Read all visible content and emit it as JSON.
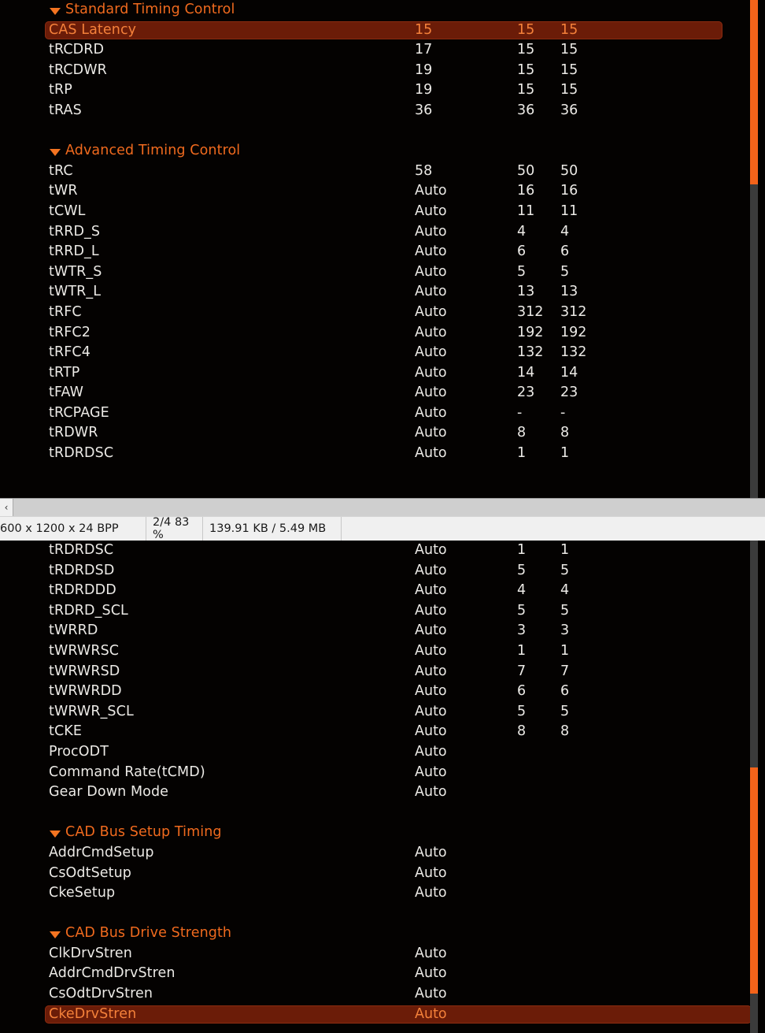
{
  "app": {
    "kind": "bios-memory-timing-screenshot-in-image-viewer"
  },
  "colors": {
    "accent_orange": "#f4631a",
    "section_header": "#f06a1e",
    "selected_row_bg": "#6b1c08",
    "selected_row_text": "#f4813a",
    "value_text": "#eceae6",
    "panel_bg": "#040201"
  },
  "panel_top": {
    "rows": [
      {
        "type": "section",
        "label": "Standard Timing Control"
      },
      {
        "type": "item",
        "label": "CAS Latency",
        "v1": "15",
        "v2": "15",
        "v3": "15",
        "selected": true
      },
      {
        "type": "item",
        "label": "tRCDRD",
        "v1": "17",
        "v2": "15",
        "v3": "15"
      },
      {
        "type": "item",
        "label": "tRCDWR",
        "v1": "19",
        "v2": "15",
        "v3": "15"
      },
      {
        "type": "item",
        "label": "tRP",
        "v1": "19",
        "v2": "15",
        "v3": "15"
      },
      {
        "type": "item",
        "label": "tRAS",
        "v1": "36",
        "v2": "36",
        "v3": "36"
      },
      {
        "type": "spacer"
      },
      {
        "type": "section",
        "label": "Advanced Timing Control"
      },
      {
        "type": "item",
        "label": "tRC",
        "v1": "58",
        "v2": "50",
        "v3": "50"
      },
      {
        "type": "item",
        "label": "tWR",
        "v1": "Auto",
        "v2": "16",
        "v3": "16"
      },
      {
        "type": "item",
        "label": "tCWL",
        "v1": "Auto",
        "v2": "11",
        "v3": "11"
      },
      {
        "type": "item",
        "label": "tRRD_S",
        "v1": "Auto",
        "v2": "4",
        "v3": "4"
      },
      {
        "type": "item",
        "label": "tRRD_L",
        "v1": "Auto",
        "v2": "6",
        "v3": "6"
      },
      {
        "type": "item",
        "label": "tWTR_S",
        "v1": "Auto",
        "v2": "5",
        "v3": "5"
      },
      {
        "type": "item",
        "label": "tWTR_L",
        "v1": "Auto",
        "v2": "13",
        "v3": "13"
      },
      {
        "type": "item",
        "label": "tRFC",
        "v1": "Auto",
        "v2": "312",
        "v3": "312"
      },
      {
        "type": "item",
        "label": "tRFC2",
        "v1": "Auto",
        "v2": "192",
        "v3": "192"
      },
      {
        "type": "item",
        "label": "tRFC4",
        "v1": "Auto",
        "v2": "132",
        "v3": "132"
      },
      {
        "type": "item",
        "label": "tRTP",
        "v1": "Auto",
        "v2": "14",
        "v3": "14"
      },
      {
        "type": "item",
        "label": "tFAW",
        "v1": "Auto",
        "v2": "23",
        "v3": "23"
      },
      {
        "type": "item",
        "label": "tRCPAGE",
        "v1": "Auto",
        "v2": "-",
        "v3": "-"
      },
      {
        "type": "item",
        "label": "tRDWR",
        "v1": "Auto",
        "v2": "8",
        "v3": "8"
      },
      {
        "type": "item",
        "label": "tRDRDSC",
        "v1": "Auto",
        "v2": "1",
        "v3": "1"
      }
    ],
    "scrollbar": {
      "thumb_top_pct": 0,
      "thumb_height_pct": 37
    }
  },
  "panel_bottom": {
    "rows": [
      {
        "type": "item",
        "label": "tRDRDSC",
        "v1": "Auto",
        "v2": "1",
        "v3": "1"
      },
      {
        "type": "item",
        "label": "tRDRDSD",
        "v1": "Auto",
        "v2": "5",
        "v3": "5"
      },
      {
        "type": "item",
        "label": "tRDRDDD",
        "v1": "Auto",
        "v2": "4",
        "v3": "4"
      },
      {
        "type": "item",
        "label": "tRDRD_SCL",
        "v1": "Auto",
        "v2": "5",
        "v3": "5"
      },
      {
        "type": "item",
        "label": "tWRRD",
        "v1": "Auto",
        "v2": "3",
        "v3": "3"
      },
      {
        "type": "item",
        "label": "tWRWRSC",
        "v1": "Auto",
        "v2": "1",
        "v3": "1"
      },
      {
        "type": "item",
        "label": "tWRWRSD",
        "v1": "Auto",
        "v2": "7",
        "v3": "7"
      },
      {
        "type": "item",
        "label": "tWRWRDD",
        "v1": "Auto",
        "v2": "6",
        "v3": "6"
      },
      {
        "type": "item",
        "label": "tWRWR_SCL",
        "v1": "Auto",
        "v2": "5",
        "v3": "5"
      },
      {
        "type": "item",
        "label": "tCKE",
        "v1": "Auto",
        "v2": "8",
        "v3": "8"
      },
      {
        "type": "item",
        "label": "ProcODT",
        "v1": "Auto",
        "v2": "",
        "v3": ""
      },
      {
        "type": "item",
        "label": "Command Rate(tCMD)",
        "v1": "Auto",
        "v2": "",
        "v3": ""
      },
      {
        "type": "item",
        "label": "Gear Down Mode",
        "v1": "Auto",
        "v2": "",
        "v3": ""
      },
      {
        "type": "spacer"
      },
      {
        "type": "section",
        "label": "CAD Bus Setup Timing"
      },
      {
        "type": "item",
        "label": "AddrCmdSetup",
        "v1": "Auto",
        "v2": "",
        "v3": ""
      },
      {
        "type": "item",
        "label": "CsOdtSetup",
        "v1": "Auto",
        "v2": "",
        "v3": ""
      },
      {
        "type": "item",
        "label": "CkeSetup",
        "v1": "Auto",
        "v2": "",
        "v3": ""
      },
      {
        "type": "spacer"
      },
      {
        "type": "section",
        "label": "CAD Bus Drive Strength"
      },
      {
        "type": "item",
        "label": "ClkDrvStren",
        "v1": "Auto",
        "v2": "",
        "v3": ""
      },
      {
        "type": "item",
        "label": "AddrCmdDrvStren",
        "v1": "Auto",
        "v2": "",
        "v3": ""
      },
      {
        "type": "item",
        "label": "CsOdtDrvStren",
        "v1": "Auto",
        "v2": "",
        "v3": ""
      },
      {
        "type": "item",
        "label": "CkeDrvStren",
        "v1": "Auto",
        "v2": "",
        "v3": "",
        "selected": true
      }
    ],
    "scrollbar": {
      "thumb_top_pct": 46,
      "thumb_height_pct": 46
    }
  },
  "viewer": {
    "hscroll": {
      "left_arrow_glyph": "‹"
    },
    "status": {
      "dimensions": "600 x 1200 x 24 BPP",
      "page_and_zoom": "2/4 83 %",
      "filesize": "139.91 KB / 5.49 MB",
      "extra": ""
    }
  }
}
